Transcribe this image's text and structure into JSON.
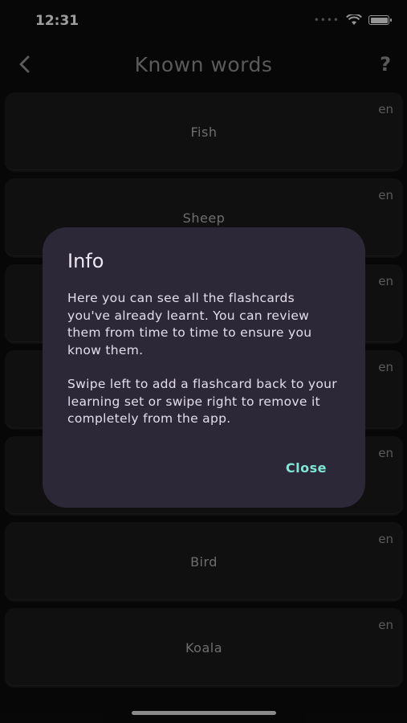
{
  "status_bar": {
    "time": "12:31"
  },
  "header": {
    "title": "Known words",
    "help_label": "?"
  },
  "word_list": [
    {
      "word": "Fish",
      "lang": "en"
    },
    {
      "word": "Sheep",
      "lang": "en"
    },
    {
      "word": "",
      "lang": "en"
    },
    {
      "word": "",
      "lang": "en"
    },
    {
      "word": "",
      "lang": "en"
    },
    {
      "word": "Bird",
      "lang": "en"
    },
    {
      "word": "Koala",
      "lang": "en"
    }
  ],
  "dialog": {
    "title": "Info",
    "paragraph1": "Here you can see all the flashcards you've already learnt. You can review them from time to time to ensure you know them.",
    "paragraph2": "Swipe left to add a flashcard back to your learning set or swipe right to remove it completely from the app.",
    "close_label": "Close"
  },
  "colors": {
    "accent": "#7ee8d4",
    "dialog_bg": "#2d2838",
    "card_bg": "#191919"
  }
}
